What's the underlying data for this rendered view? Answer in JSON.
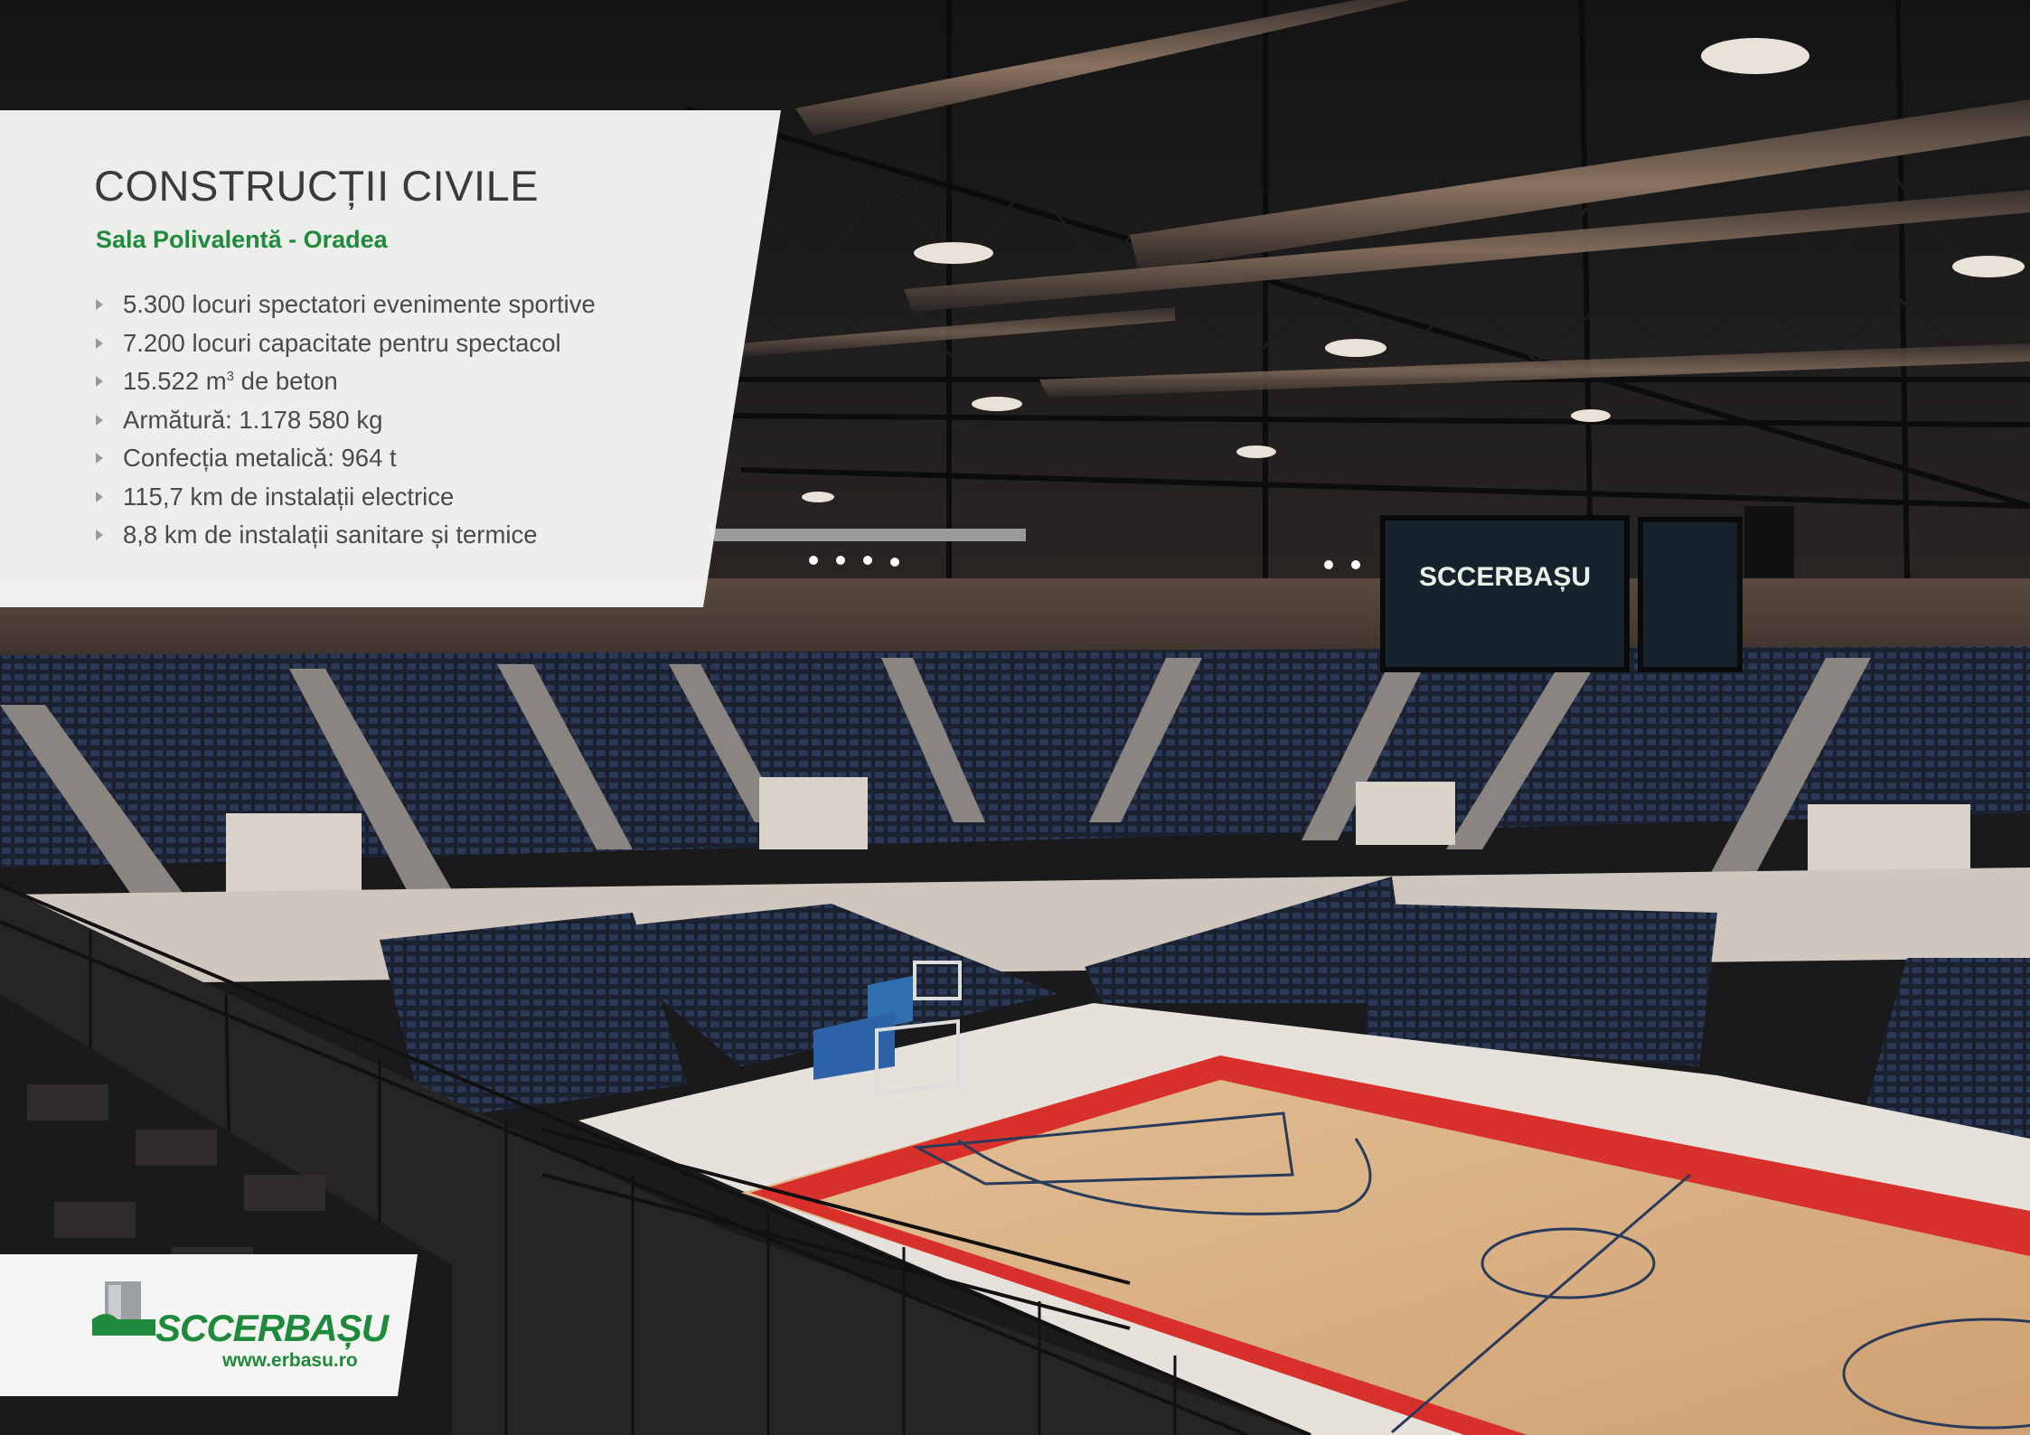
{
  "section_title": "CONSTRUCȚII CIVILE",
  "project_name": "Sala Polivalentă - Oradea",
  "facts": [
    {
      "text": "5.300 locuri spectatori evenimente sportive"
    },
    {
      "text": "7.200 locuri capacitate pentru spectacol"
    },
    {
      "text_before": "15.522 m",
      "superscript": "3",
      "text_after": " de beton"
    },
    {
      "text": "Armătură: 1.178 580 kg"
    },
    {
      "text": "Confecția metalică: 964 t"
    },
    {
      "text": "115,7 km de instalații electrice"
    },
    {
      "text": "8,8 km de instalații sanitare și termice"
    }
  ],
  "logo": {
    "name": "SCCERBAȘU",
    "url": "www.erbasu.ro"
  },
  "colors": {
    "brand_green": "#1f8a3b",
    "court_red": "#d8302a",
    "court_wood": "#d9b083",
    "seat_blue": "#2a3550"
  },
  "icons": [
    "bullet-triangle-icon",
    "company-building-logo-icon"
  ]
}
